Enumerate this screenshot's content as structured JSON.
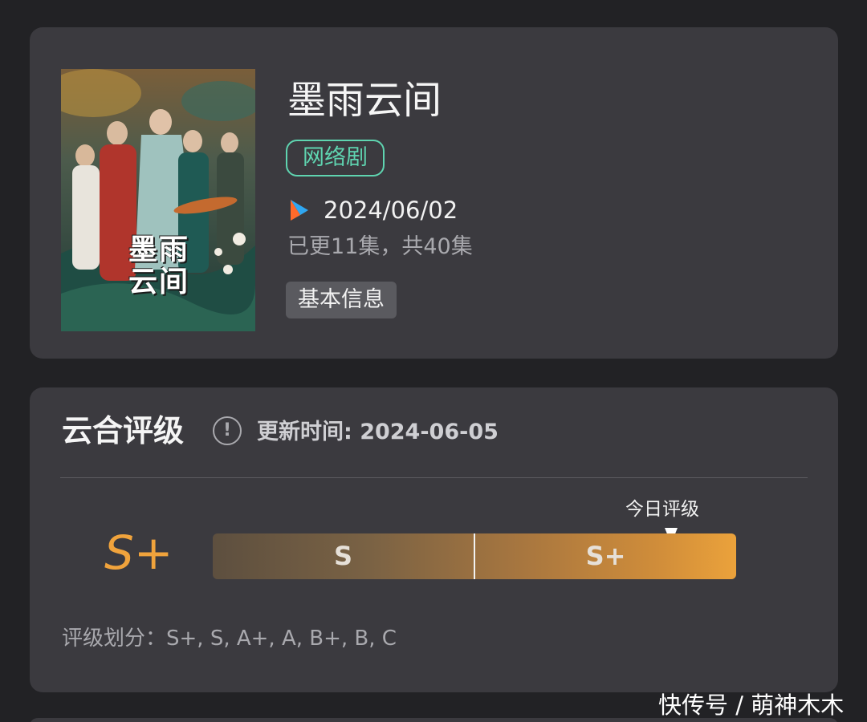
{
  "show": {
    "title": "墨雨云间",
    "poster_title_line1": "墨雨",
    "poster_title_line2": "云间",
    "type_tag": "网络剧",
    "platform_icon": "youku-play-icon",
    "air_date": "2024/06/02",
    "episodes": "已更11集，共40集",
    "info_button": "基本信息"
  },
  "rating": {
    "title": "云合评级",
    "info_icon": "info-circle-icon",
    "update_time": "更新时间: 2024-06-05",
    "current_grade": "S+",
    "today_label": "今日评级",
    "today_position": 0.875,
    "segments": [
      "S",
      "S+"
    ],
    "tier_description": "评级划分：S+, S, A+, A, B+, B, C",
    "colors": {
      "accent": "#f0a33c",
      "tag": "#5fd4b0"
    }
  },
  "watermark": "快传号 / 萌神木木"
}
